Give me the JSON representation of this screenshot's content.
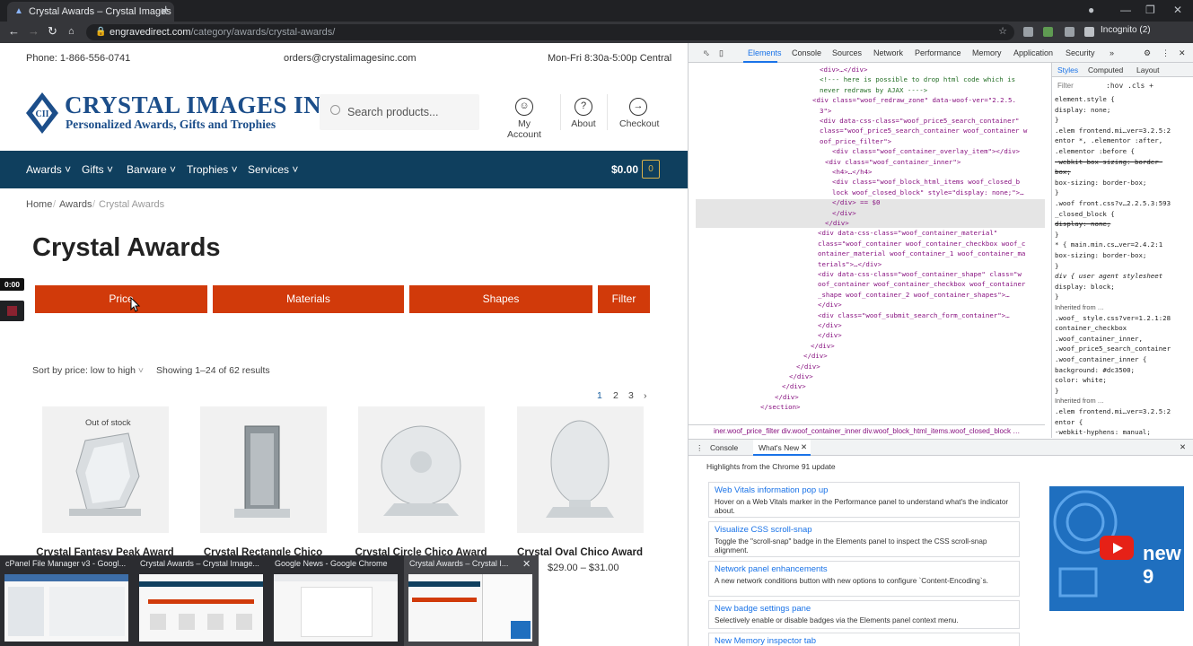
{
  "browser": {
    "tab_title": "Crystal Awards – Crystal Images",
    "new_tab": "+",
    "url_host": "engravedirect.com",
    "url_path": "/category/awards/crystal-awards/",
    "profile": "Incognito (2)"
  },
  "site": {
    "phone": "Phone: 1-866-556-0741",
    "email": "orders@crystalimagesinc.com",
    "hours": "Mon-Fri 8:30a-5:00p Central",
    "logo_title": "CRYSTAL IMAGES INC.",
    "logo_subtitle": "Personalized Awards, Gifts and Trophies",
    "search_placeholder": "Search products...",
    "header_links": [
      "My Account",
      "About",
      "Checkout"
    ],
    "nav": [
      "Awards",
      "Gifts",
      "Barware",
      "Trophies",
      "Services"
    ],
    "cart_total": "$0.00",
    "cart_count": "0",
    "breadcrumb": [
      "Home",
      "Awards",
      "Crystal Awards"
    ],
    "page_title": "Crystal Awards",
    "filter_buttons": [
      "Price",
      "Materials",
      "Shapes",
      "Filter"
    ],
    "sort_label": "Sort by price: low to high",
    "result_count": "Showing 1–24 of 62 results",
    "pages": [
      "1",
      "2",
      "3"
    ],
    "out_of_stock": "Out of stock",
    "products": [
      {
        "name": "Crystal Fantasy Peak Award",
        "price": ""
      },
      {
        "name": "Crystal Rectangle Chico",
        "price": ""
      },
      {
        "name": "Crystal Circle Chico Award",
        "price": ""
      },
      {
        "name": "Crystal Oval Chico Award",
        "price": "$29.00 – $31.00"
      }
    ],
    "timer": "0:00"
  },
  "devtools": {
    "tabs": [
      "Elements",
      "Console",
      "Sources",
      "Network",
      "Performance",
      "Memory",
      "Application",
      "Security"
    ],
    "dom_lines": [
      "<div>…</div>",
      "<!--- here is possible to drop html code which is",
      "never redraws by AJAX ---->",
      "<div class=\"woof_redraw_zone\" data-woof-ver=\"2.2.5.",
      "3\">",
      "<div data-css-class=\"woof_price5_search_container\"",
      "class=\"woof_price5_search_container woof_container w",
      "oof_price_filter\">",
      "<div class=\"woof_container_overlay_item\"></div>",
      "<div class=\"woof_container_inner\">",
      "<h4>…</h4>",
      "<div class=\"woof_block_html_items woof_closed_b",
      "lock woof_closed_block\" style=\"display: none;\">…",
      "</div> == $0",
      "</div>",
      "</div>",
      "<div data-css-class=\"woof_container_material\"",
      "class=\"woof_container woof_container_checkbox woof_c",
      "ontainer_material woof_container_1 woof_container_ma",
      "terials\">…</div>",
      "<div data-css-class=\"woof_container_shape\" class=\"w",
      "oof_container woof_container_checkbox woof_container",
      "_shape woof_container_2 woof_container_shapes\">…",
      "</div>",
      "<div class=\"woof_submit_search_form_container\">…",
      "</div>",
      "</div>",
      "</div>",
      "</div>",
      "</div>",
      "</div>",
      "</div>",
      "</div>",
      "</section>"
    ],
    "dom_breadcrumb": "iner.woof_price_filter   div.woof_container_inner   div.woof_block_html_items.woof_closed_block   …",
    "styles_tabs": [
      "Styles",
      "Computed",
      "Layout"
    ],
    "styles_filter": "Filter",
    "styles_hov": ":hov  .cls  +",
    "styles_lines": [
      "element.style {",
      "  display: none;",
      "}",
      ".elem   frontend.mi…ver=3.2.5:2",
      "entor *, .elementor :after,",
      ".elementor :before {",
      "  -webkit-box-sizing: border-",
      "  box;",
      "  box-sizing: border-box;",
      "}",
      ".woof   front.css?v…2.2.5.3:593",
      "_closed_block {",
      "  display: none;",
      "}",
      "* {      main.min.cs…ver=2.4.2:1",
      "  box-sizing: border-box;",
      "}",
      "div {    user agent stylesheet",
      "  display: block;",
      "}",
      "Inherited from …",
      ".woof_   style.css?ver=1.2.1:28",
      "container_checkbox",
      ".woof_container_inner,",
      ".woof_price5_search_container",
      ".woof_container_inner {",
      "  background:  #dc3500;",
      "  color:  white;",
      "}",
      "Inherited from …",
      ".elem   frontend.mi…ver=3.2.5:2",
      "entor {",
      "  -webkit-hyphens: manual;",
      "  -ms-hyphens: manual;"
    ],
    "drawer_tabs": [
      "Console",
      "What's New"
    ],
    "whats_new_title": "Highlights from the Chrome 91 update",
    "whats_new": [
      {
        "title": "Web Vitals information pop up",
        "desc": "Hover on a Web Vitals marker in the Performance panel to understand what's the indicator about."
      },
      {
        "title": "Visualize CSS scroll-snap",
        "desc": "Toggle the \"scroll-snap\" badge in the Elements panel to inspect the CSS scroll-snap alignment."
      },
      {
        "title": "Network panel enhancements",
        "desc": "A new network conditions button with new options to configure `Content-Encoding`s."
      },
      {
        "title": "New badge settings pane",
        "desc": "Selectively enable or disable badges via the Elements panel context menu."
      },
      {
        "title": "New Memory inspector tab",
        "desc": ""
      }
    ],
    "video_text": "new 9"
  },
  "taskbar": [
    "cPanel File Manager v3 - Googl...",
    "Crystal Awards – Crystal Image...",
    "Google News - Google Chrome",
    "Crystal Awards – Crystal I..."
  ],
  "colors": {
    "accent_red": "#d13a0a",
    "nav_blue": "#0f3f5e",
    "logo_blue": "#1c4e8a"
  }
}
